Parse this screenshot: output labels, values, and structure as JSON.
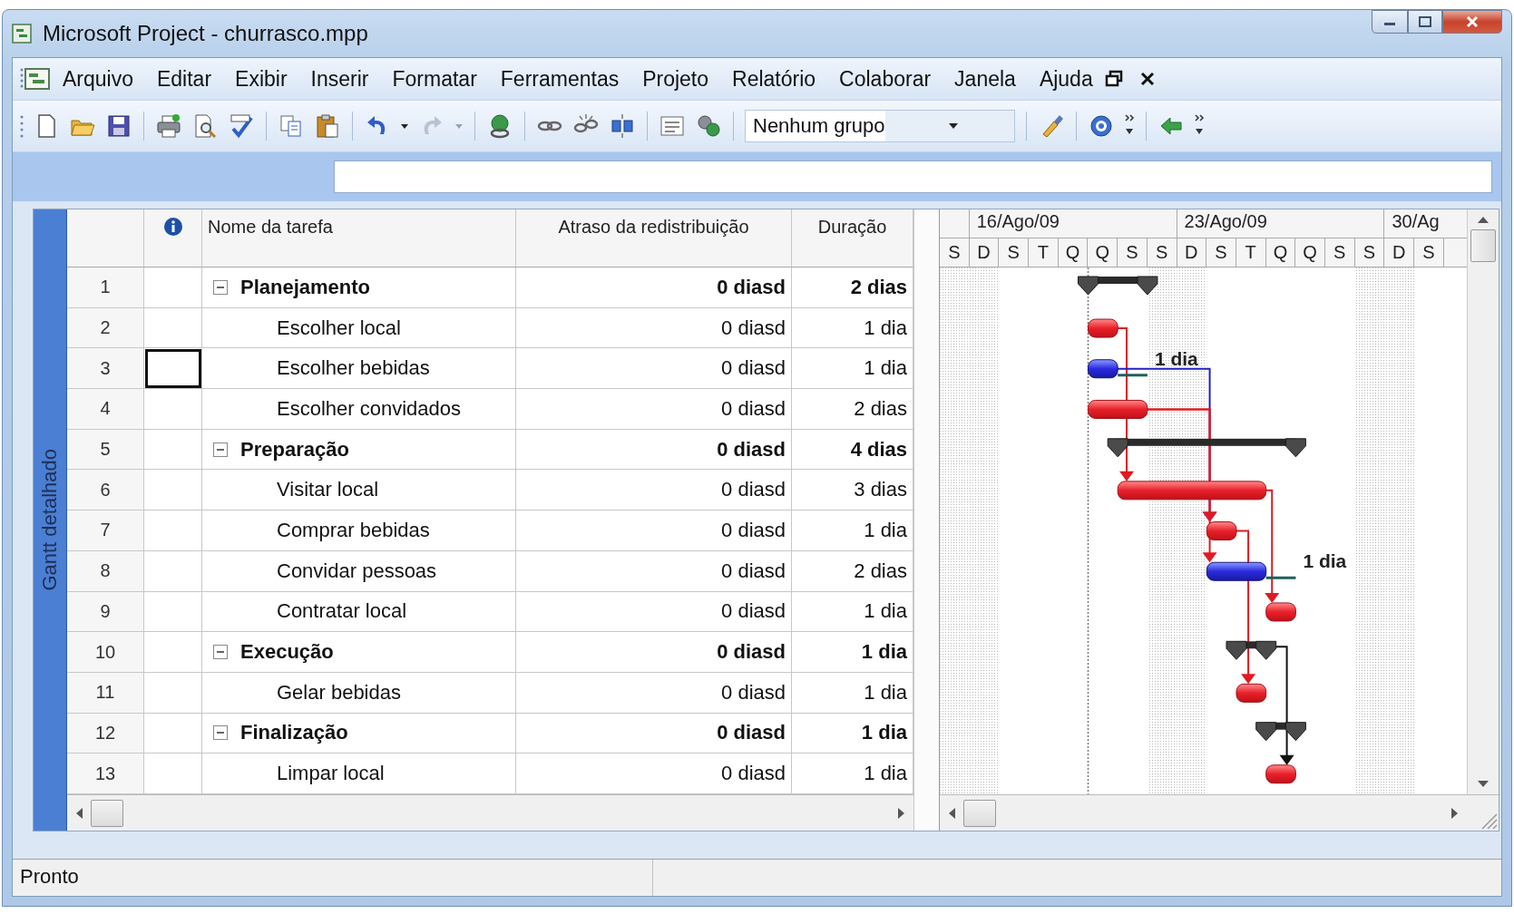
{
  "window": {
    "title": "Microsoft Project - churrasco.mpp"
  },
  "menu": [
    "Arquivo",
    "Editar",
    "Exibir",
    "Inserir",
    "Formatar",
    "Ferramentas",
    "Projeto",
    "Relatório",
    "Colaborar",
    "Janela",
    "Ajuda"
  ],
  "toolbar": {
    "group_filter": "Nenhum grupo",
    "redo_enabled": false
  },
  "view_bar": {
    "label": "Gantt detalhado"
  },
  "table": {
    "columns": [
      "Nome da tarefa",
      "Atraso da redistribuição",
      "Duração"
    ],
    "tasks": [
      {
        "id": "1",
        "name": "Planejamento",
        "leveling_delay": "0 diasd",
        "duration": "2 dias",
        "kind": "summary",
        "expanded": true,
        "selected": false,
        "children": [
          {
            "id": "2",
            "name": "Escolher local",
            "leveling_delay": "0 diasd",
            "duration": "1 dia",
            "kind": "task",
            "critical": true,
            "selected": false
          },
          {
            "id": "3",
            "name": "Escolher bebidas",
            "leveling_delay": "0 diasd",
            "duration": "1 dia",
            "kind": "task",
            "critical": false,
            "selected": true,
            "bar_label": "1 dia"
          },
          {
            "id": "4",
            "name": "Escolher convidados",
            "leveling_delay": "0 diasd",
            "duration": "2 dias",
            "kind": "task",
            "critical": true,
            "selected": false
          }
        ]
      },
      {
        "id": "5",
        "name": "Preparação",
        "leveling_delay": "0 diasd",
        "duration": "4 dias",
        "kind": "summary",
        "expanded": true,
        "selected": false,
        "children": [
          {
            "id": "6",
            "name": "Visitar local",
            "leveling_delay": "0 diasd",
            "duration": "3 dias",
            "kind": "task",
            "critical": true,
            "selected": false
          },
          {
            "id": "7",
            "name": "Comprar bebidas",
            "leveling_delay": "0 diasd",
            "duration": "1 dia",
            "kind": "task",
            "critical": true,
            "selected": false
          },
          {
            "id": "8",
            "name": "Convidar pessoas",
            "leveling_delay": "0 diasd",
            "duration": "2 dias",
            "kind": "task",
            "critical": false,
            "selected": false,
            "bar_label": "1 dia"
          },
          {
            "id": "9",
            "name": "Contratar local",
            "leveling_delay": "0 diasd",
            "duration": "1 dia",
            "kind": "task",
            "critical": true,
            "selected": false
          }
        ]
      },
      {
        "id": "10",
        "name": "Execução",
        "leveling_delay": "0 diasd",
        "duration": "1 dia",
        "kind": "summary",
        "expanded": true,
        "selected": false,
        "children": [
          {
            "id": "11",
            "name": "Gelar bebidas",
            "leveling_delay": "0 diasd",
            "duration": "1 dia",
            "kind": "task",
            "critical": true,
            "selected": false
          }
        ]
      },
      {
        "id": "12",
        "name": "Finalização",
        "leveling_delay": "0 diasd",
        "duration": "1 dia",
        "kind": "summary",
        "expanded": true,
        "selected": false,
        "children": [
          {
            "id": "13",
            "name": "Limpar local",
            "leveling_delay": "0 diasd",
            "duration": "1 dia",
            "kind": "task",
            "critical": true,
            "selected": false
          }
        ]
      }
    ]
  },
  "gantt": {
    "weeks": [
      "16/Ago/09",
      "23/Ago/09",
      "30/Ag"
    ],
    "days": [
      "S",
      "D",
      "S",
      "T",
      "Q",
      "Q",
      "S",
      "S",
      "D",
      "S",
      "T",
      "Q",
      "Q",
      "S",
      "S",
      "D",
      "S"
    ]
  },
  "status_bar": {
    "text": "Pronto"
  }
}
